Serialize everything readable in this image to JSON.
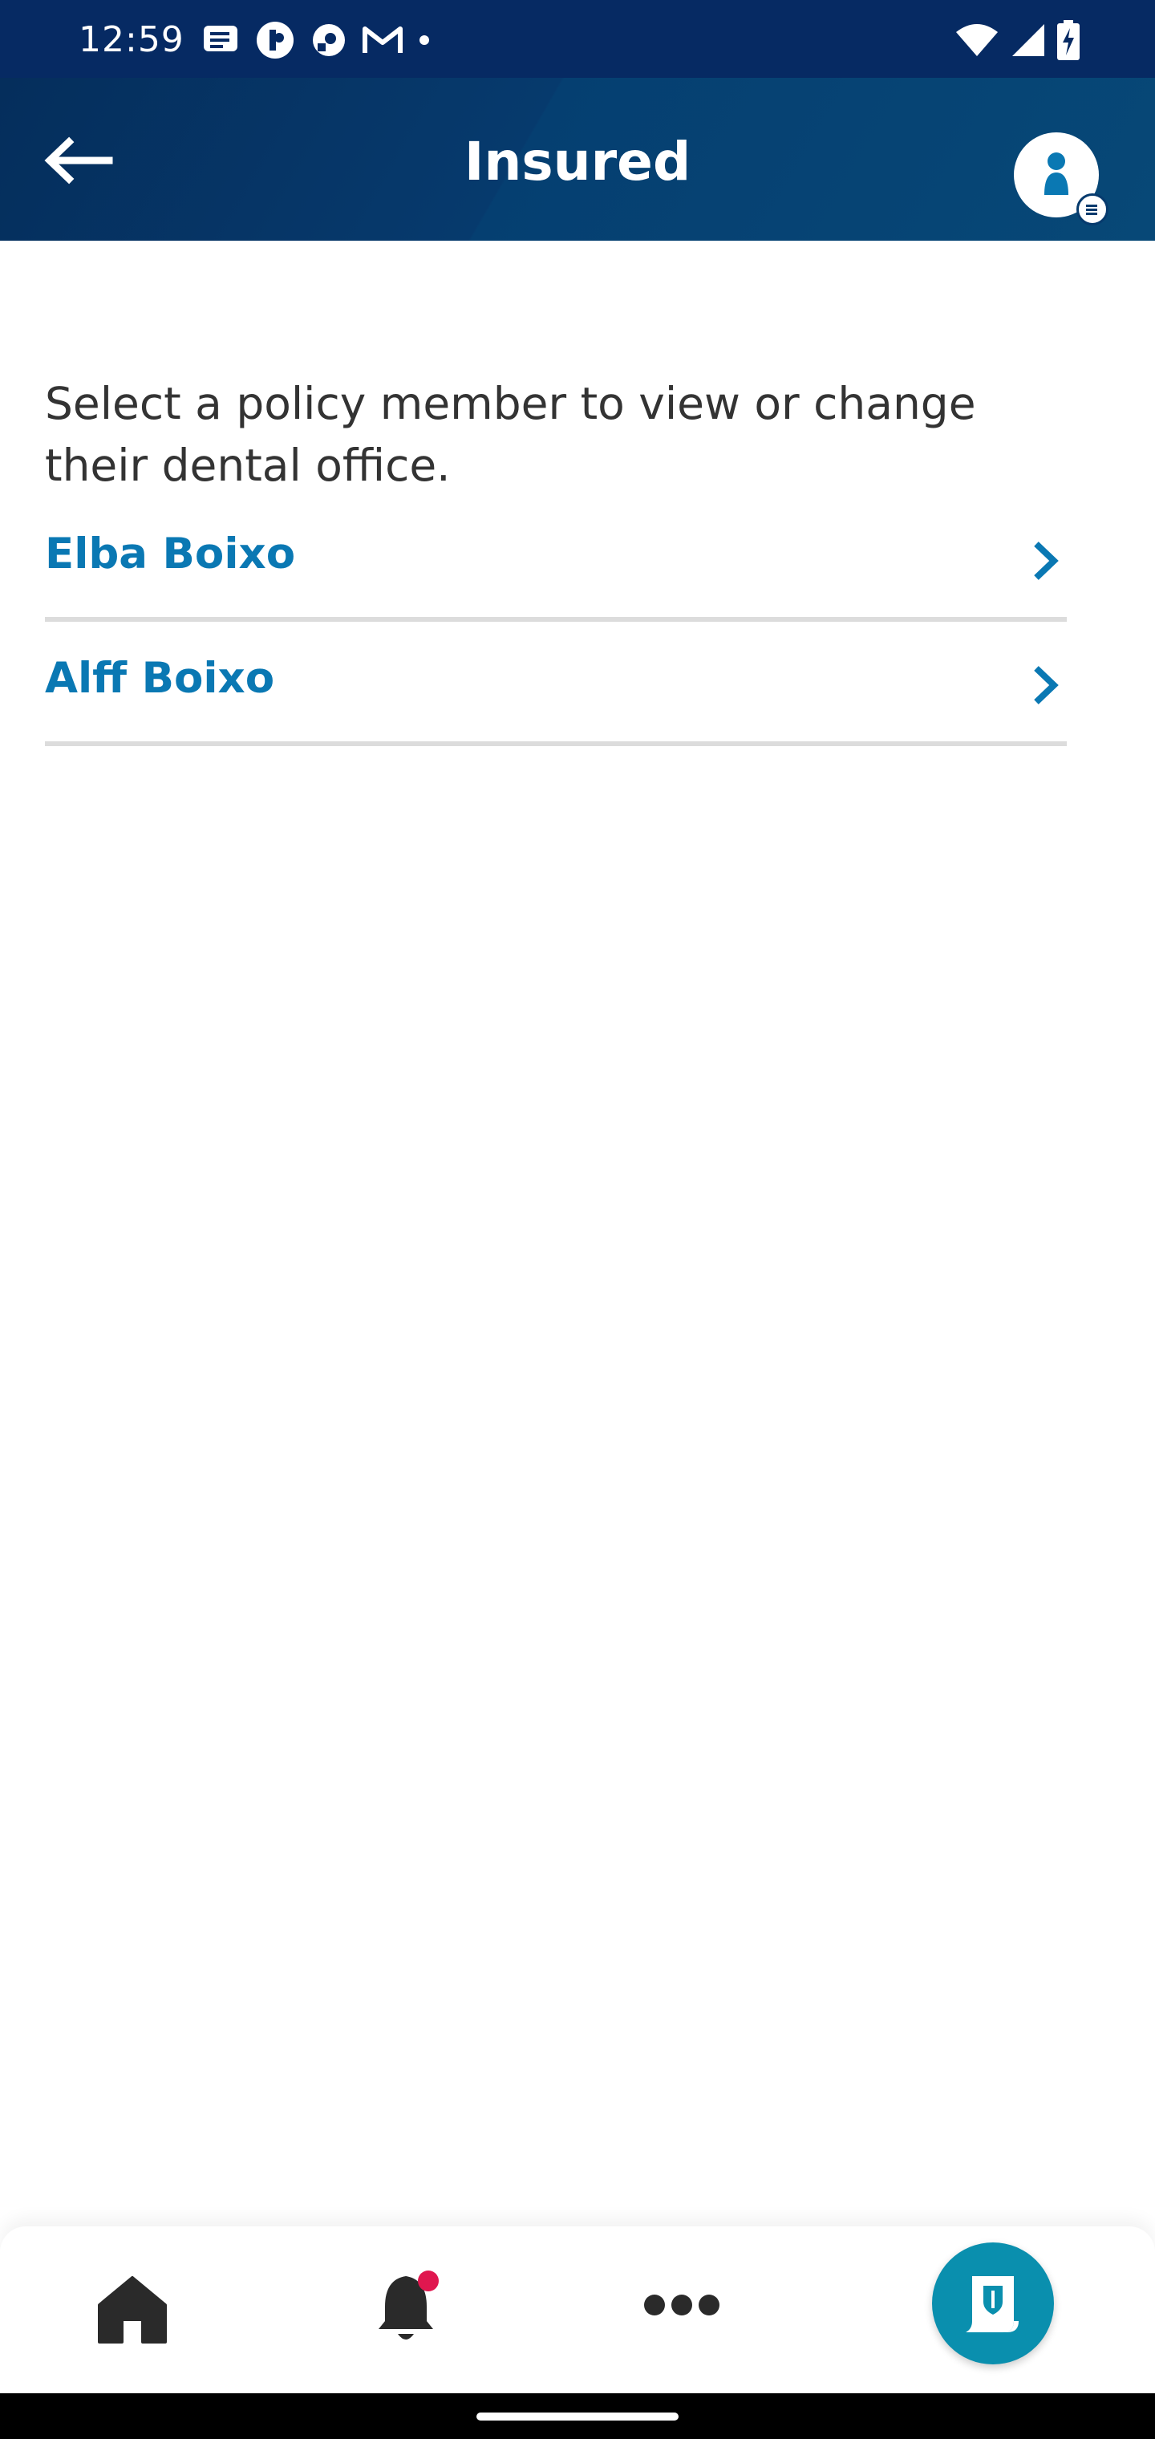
{
  "status_bar": {
    "time": "12:59",
    "left_icons": [
      "message-icon",
      "notification-app-icon",
      "chat-app-icon",
      "gmail-icon",
      "dot-icon"
    ],
    "right_icons": [
      "wifi-icon",
      "cellular-signal-icon",
      "battery-charging-icon"
    ]
  },
  "header": {
    "title": "Insured",
    "back_icon": "arrow-left-icon",
    "profile_icon": "person-icon"
  },
  "main": {
    "intro_text": "Select a policy member to view or change their dental office.",
    "members": [
      {
        "name": "Elba Boixo"
      },
      {
        "name": "Alff Boixo"
      }
    ]
  },
  "bottom_nav": {
    "items": [
      "home-icon",
      "bell-icon",
      "more-icon",
      "id-card-icon"
    ],
    "notification_badge_color": "#e0174f",
    "active_button_color": "#0a8fae"
  },
  "colors": {
    "header_bg": "#063a6d",
    "status_bar_bg": "#062a63",
    "link_blue": "#0a78b3",
    "body_text": "#333333"
  }
}
